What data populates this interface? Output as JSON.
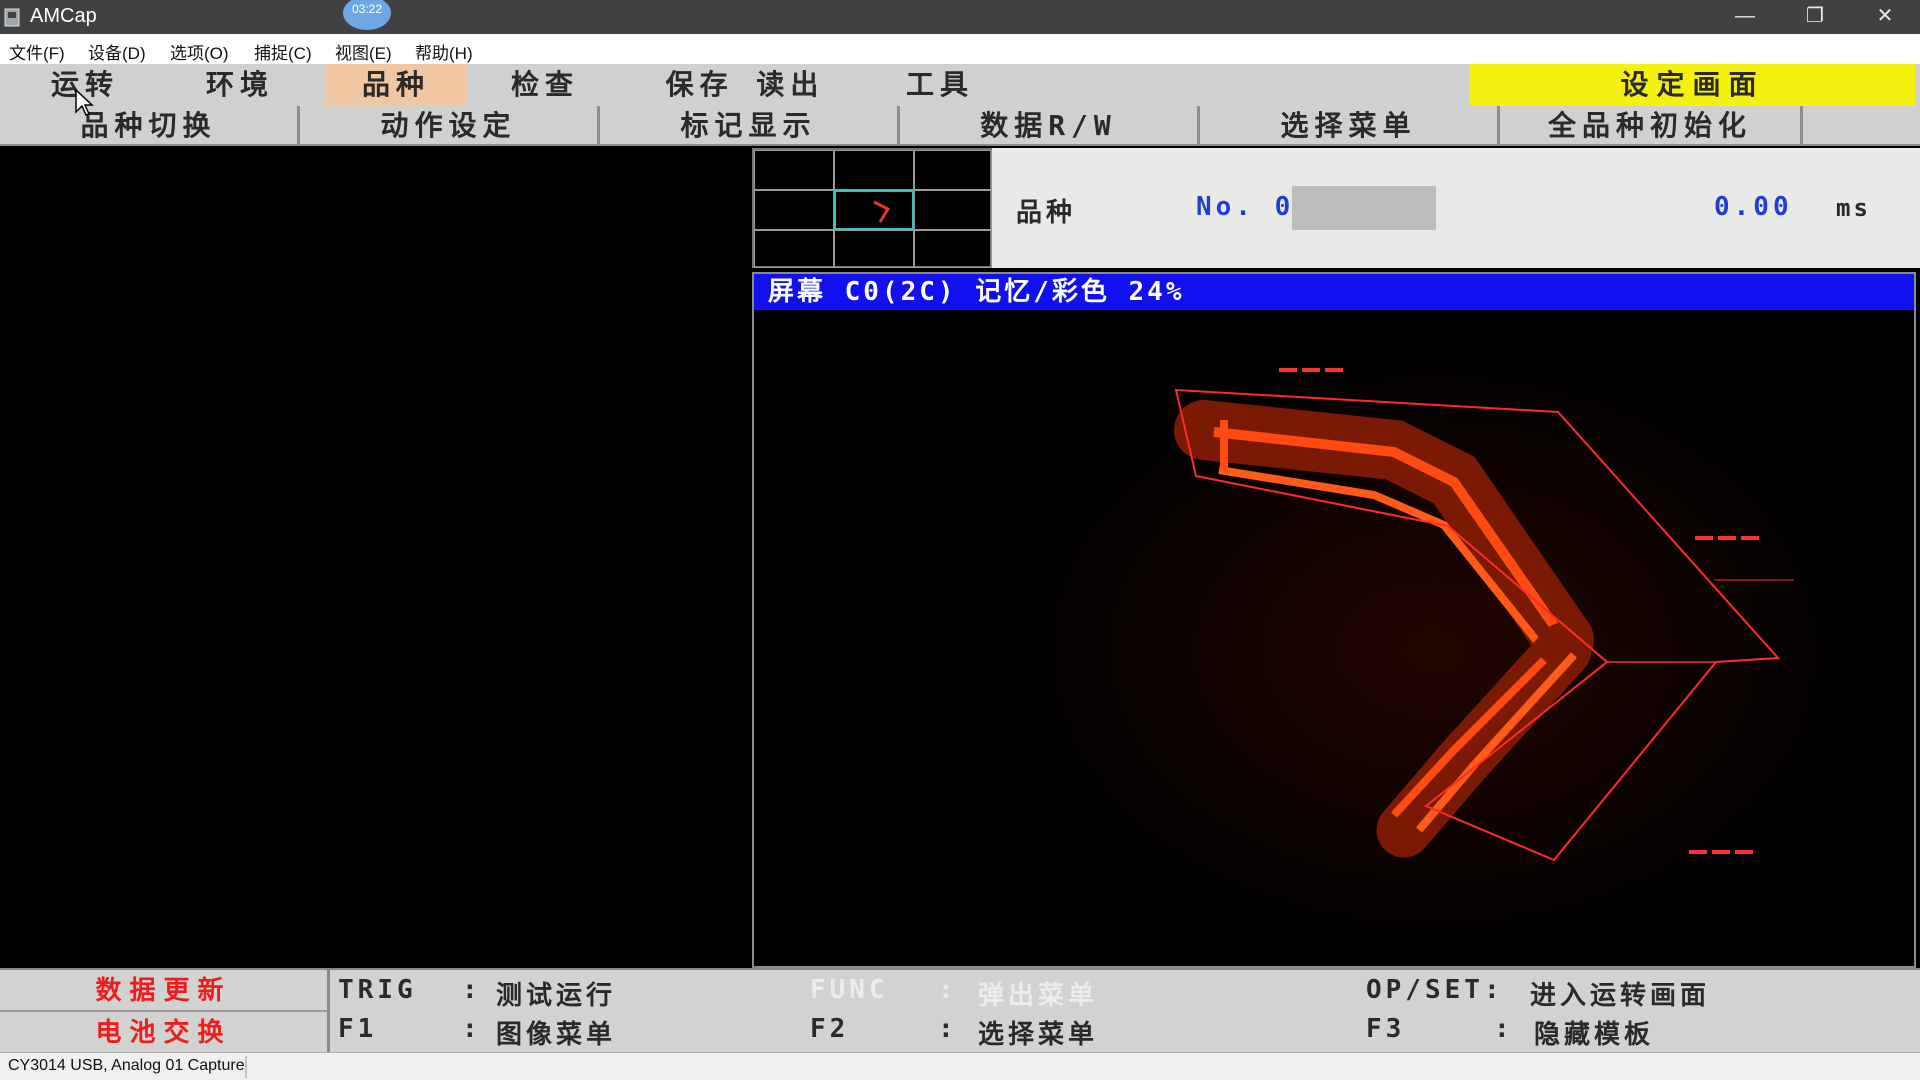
{
  "window": {
    "title": "AMCap",
    "clock_badge": "03:22",
    "controls": {
      "minimize": "—",
      "restore": "❐",
      "close": "✕"
    }
  },
  "menu": [
    "文件(F)",
    "设备(D)",
    "选项(O)",
    "捕捉(C)",
    "视图(E)",
    "帮助(H)"
  ],
  "tabs": [
    "运转",
    "环境",
    "品种",
    "检查",
    "保存 读出",
    "工具"
  ],
  "setting_screen": "设定画面",
  "subtabs": [
    "品种切换",
    "动作设定",
    "标记显示",
    "数据R/W",
    "选择菜单",
    "全品种初始化"
  ],
  "info": {
    "product_label": "品种",
    "product_no": "No. 001",
    "time_value": "0.00",
    "time_unit": "ms"
  },
  "camera": {
    "header": "屏幕 C0(2C) 记忆/彩色 24%"
  },
  "bottom": {
    "red_buttons": [
      "数据更新",
      "电池交换"
    ],
    "row1": [
      {
        "key": "TRIG",
        "sep": ":",
        "action": "测试运行"
      },
      {
        "key": "FUNC",
        "sep": ":",
        "action": "弹出菜单"
      },
      {
        "key": "OP/SET",
        "sep": ":",
        "action": "进入运转画面"
      }
    ],
    "row2": [
      {
        "key": "F1",
        "sep": ":",
        "action": "图像菜单"
      },
      {
        "key": "F2",
        "sep": ":",
        "action": "选择菜单"
      },
      {
        "key": "F3",
        "sep": ":",
        "action": "隐藏模板"
      }
    ]
  },
  "status": "CY3014 USB, Analog 01 Capture",
  "colors": {
    "tab_active": "#f1c7a3",
    "setting_yellow": "#f5f10e",
    "header_blue": "#1010f0",
    "number_blue": "#1f3fcf",
    "red_text": "#ee1c1c"
  }
}
